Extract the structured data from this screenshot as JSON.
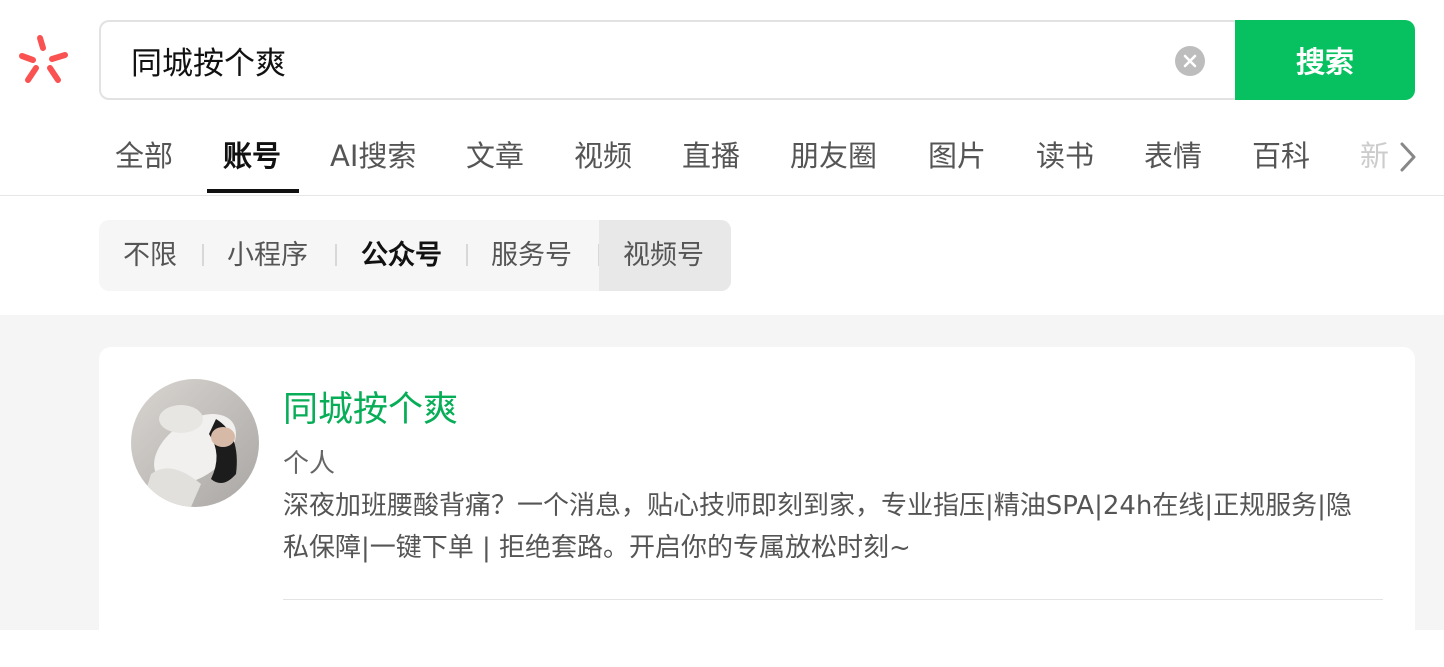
{
  "search": {
    "query": "同城按个爽",
    "button_label": "搜索"
  },
  "tabs": [
    {
      "label": "全部"
    },
    {
      "label": "账号"
    },
    {
      "label": "AI搜索"
    },
    {
      "label": "文章"
    },
    {
      "label": "视频"
    },
    {
      "label": "直播"
    },
    {
      "label": "朋友圈"
    },
    {
      "label": "图片"
    },
    {
      "label": "读书"
    },
    {
      "label": "表情"
    },
    {
      "label": "百科"
    },
    {
      "label": "新"
    }
  ],
  "active_tab": "账号",
  "subfilters": [
    {
      "label": "不限"
    },
    {
      "label": "小程序"
    },
    {
      "label": "公众号"
    },
    {
      "label": "服务号"
    },
    {
      "label": "视频号"
    }
  ],
  "active_subfilter": "公众号",
  "result": {
    "name": "同城按个爽",
    "type": "个人",
    "description": "深夜加班腰酸背痛？一个消息，贴心技师即刻到家，专业指压|精油SPA|24h在线|正规服务|隐私保障|一键下单 | 拒绝套路。开启你的专属放松时刻~"
  },
  "colors": {
    "brand_green": "#07c160",
    "name_green": "#07ad57",
    "logo_red": "#fa5151"
  },
  "icons": {
    "logo": "search-logo-icon",
    "clear": "clear-icon",
    "more": "chevron-right-icon"
  }
}
